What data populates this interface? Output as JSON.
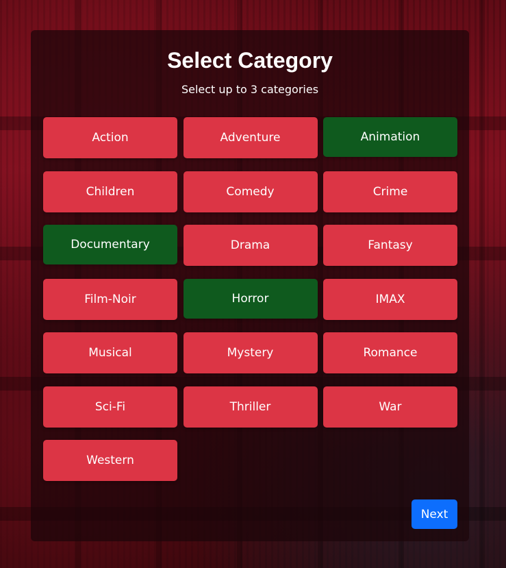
{
  "page": {
    "title": "Select Category",
    "subtitle": "Select up to 3 categories",
    "next_label": "Next"
  },
  "colors": {
    "unselected": "#dc3545",
    "selected": "#0f5a1e",
    "primary": "#0d6efd"
  },
  "categories": [
    {
      "label": "Action",
      "selected": false
    },
    {
      "label": "Adventure",
      "selected": false
    },
    {
      "label": "Animation",
      "selected": true
    },
    {
      "label": "Children",
      "selected": false
    },
    {
      "label": "Comedy",
      "selected": false
    },
    {
      "label": "Crime",
      "selected": false
    },
    {
      "label": "Documentary",
      "selected": true
    },
    {
      "label": "Drama",
      "selected": false
    },
    {
      "label": "Fantasy",
      "selected": false
    },
    {
      "label": "Film-Noir",
      "selected": false
    },
    {
      "label": "Horror",
      "selected": true
    },
    {
      "label": "IMAX",
      "selected": false
    },
    {
      "label": "Musical",
      "selected": false
    },
    {
      "label": "Mystery",
      "selected": false
    },
    {
      "label": "Romance",
      "selected": false
    },
    {
      "label": "Sci-Fi",
      "selected": false
    },
    {
      "label": "Thriller",
      "selected": false
    },
    {
      "label": "War",
      "selected": false
    },
    {
      "label": "Western",
      "selected": false
    }
  ]
}
